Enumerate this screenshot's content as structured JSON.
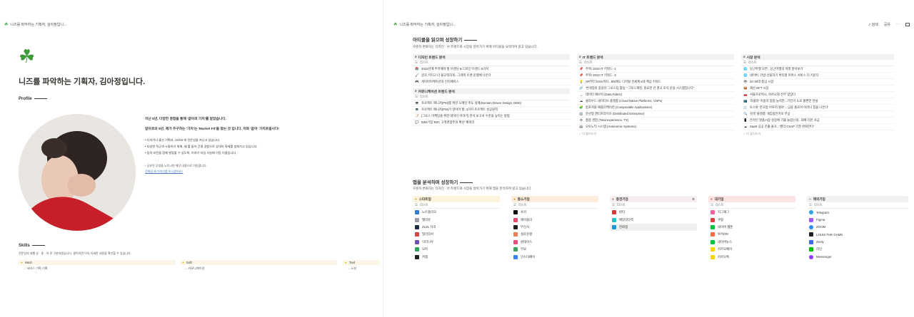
{
  "left": {
    "tab_title": "니즈를 파악하는 기획자, 김아정입니...",
    "title": "니즈를 파악하는 기획자, 김아정입니다.",
    "profile_heading": "Profile",
    "intro_1": "지난 5년, 다양한 경험을 통해 '같이의 가치'를 알았습니다.",
    "intro_2": "앞으로의 5년, 제가 추구하는 '가치'는 'Market Fit'을 찾는 것 입니다. 저와 '같이' 가치로웁시다!",
    "bullets": [
      "디자이너 출신 기획자, UX/UI 에 전문성을 지니고 있습니다.",
      "다양한 직군과 소통하기 위해, 왜 를 들어 간결 경험으로 상대의 화제를 설파가고 있습니다.",
      "팀의 비전을 함께 발맞출 수 있도록, 이야기 지길 사실에 이동 이름입니다."
    ],
    "note": "* 공유된 무엇을 노트시면 해당 내용으로 이동합니다.",
    "note_link": "전체링 왜 이야기를 보시겠어요?",
    "skills_heading": "Skills",
    "skills_desc": "전문성의 레벨 상 · 중 · 하 로 구분하였습니다. 클릭하면 이유 자세한 내용을 확인할 수 있습니다.",
    "skill_cols": [
      {
        "title": "Hard",
        "items": [
          "서비스 기획 기획"
        ]
      },
      {
        "title": "Soft",
        "items": [
          "커뮤니케이션"
        ]
      },
      {
        "title": "Tool",
        "items": [
          "노션"
        ]
      }
    ]
  },
  "right": {
    "tab_title": "니즈를 파악하는 기획자, 김아정입니...",
    "actions": {
      "search": "검색",
      "share": "공유",
      "more": "⋯"
    },
    "section1": {
      "title": "아티클을 읽으며 성장하기",
      "desc": "꾸준히 변화하는 디자인 · IT 트렌드와 시장을 알아가기 위해 아티클을 요약하며 읽고 있습니다.",
      "list_label": "리스트",
      "more_label": "더 불러오기",
      "cards": [
        {
          "title": "디자인 트렌드 분석",
          "rows": [
            {
              "icon": "📚",
              "text": "2022년에 주목해야 할 브랜딩 & 디자인 트렌드 8가지"
            },
            {
              "icon": "🖌",
              "text": "글자 키지고 더 불규칙하게...그래픽 트렌 운행에 나온다"
            },
            {
              "icon": "🎮",
              "text": "게이미피케이션과 인터페이스"
            }
          ]
        },
        {
          "title": "커뮤니케이션 트렌드 분석",
          "rows": [
            {
              "icon": "💻",
              "text": "프로젝트 매니저(PM)를 위한 도메인 주도 설계(Domain Driven Design, DDD)"
            },
            {
              "icon": "💻",
              "text": "프로젝트 매니저(PM)가 알아야 할, 3가지 프로젝트 성공원칙"
            },
            {
              "icon": "📝",
              "text": "[그로스 마케팅을 위한 데이터 이야기] 분석 보고서 수준을 높이는 방법"
            },
            {
              "icon": "💬",
              "text": "B2B기업 'B2C 고객경험주의 확산' 배워라"
            }
          ]
        },
        {
          "title": "IT 트렌드 분석",
          "rows": [
            {
              "icon": "📌",
              "text": "주목! 2022 IT 키워드 -1"
            },
            {
              "icon": "📌",
              "text": "주목! 2022 IT 키워드 -2"
            },
            {
              "icon": "💡",
              "text": "XR부터 ESG까지...MS에도 디지털 전세계 5대 핵심 키워드"
            },
            {
              "icon": "🔗",
              "text": "'변개장터 중용된 그로스팀 활동' \"그로스해킹, 중요한 건 결국 조직 운용 시스템입니다\""
            },
            {
              "icon": "↔",
              "text": "데이터 패브릭 (Data Fabric)"
            },
            {
              "icon": "☁",
              "text": "클라우드 네이티브 플랫폼 (Cloud Native Platforms, CNPs)"
            },
            {
              "icon": "🧩",
              "text": "컴포저블 애플리케이션 (Composable Applications)"
            },
            {
              "icon": "🏢",
              "text": "분산형 엔터프라이즈 (Distributed Enterprise)"
            },
            {
              "icon": "⚙",
              "text": "총합 경험 (Total experience, TX)"
            },
            {
              "icon": "🤖",
              "text": "오토노믹 시스템 (Autonomic Systems)"
            }
          ]
        },
        {
          "title": "시장 분석",
          "rows": [
            {
              "icon": "🌐",
              "text": "당근마켓 모른...당근마켓의 미래 알아보기"
            },
            {
              "icon": "🌐",
              "text": "네이버, 라방·선물하기 버티컬 커머스 서비스 더 키운다"
            },
            {
              "icon": "👁",
              "text": "20·30대 충심 시장"
            },
            {
              "icon": "📦",
              "text": "재산 NFT 시장"
            },
            {
              "icon": "🚗",
              "text": "서울가로택시, 카카오와 전부 맞장다"
            },
            {
              "icon": "📺",
              "text": "'라플라' 이용자 점점 늘지만...가전거 도로 불편한 현실"
            },
            {
              "icon": "🛒",
              "text": "토스와 '한국형 이루러 될까'...'금융 플로어 이러니 칩을 나온다'"
            },
            {
              "icon": "🔍",
              "text": "검색 '플랫폼' 게임링인키로 부상"
            },
            {
              "icon": "📱",
              "text": "온라인 명품시장 성장에 기울 늘었는데...대체 더몬 사금"
            },
            {
              "icon": "☁",
              "text": "SaaS 공공 진출 물꼬...'벤더 CSAP 기준 완화한다'"
            }
          ]
        }
      ]
    },
    "section2": {
      "title": "앱을 분석하며 성장하기",
      "desc": "꾸준히 변화하는 디자인 · IT 트렌드와 시장을 알아가기 위해 앱을 분석하며 읽고 있습니다.",
      "list_label": "리스트",
      "groups": [
        {
          "title": "스타트업",
          "color": "#fbf3db",
          "items": [
            {
              "name": "노트플리오",
              "color": "#2b7bd4"
            },
            {
              "name": "밸리유",
              "color": "#9aa0a6"
            },
            {
              "name": "ZLZL 지리",
              "color": "#1f2a44"
            },
            {
              "name": "밀리의서",
              "color": "#d64545"
            },
            {
              "name": "닥터나우",
              "color": "#6b4fbb"
            },
            {
              "name": "모아",
              "color": "#2ea35a"
            },
            {
              "name": "카랩",
              "color": "#222222"
            }
          ]
        },
        {
          "title": "중소기업",
          "color": "#fbecdd",
          "items": [
            {
              "name": "쏘카",
              "color": "#111111"
            },
            {
              "name": "에이블리",
              "color": "#e64b6b"
            },
            {
              "name": "무신사",
              "color": "#222222"
            },
            {
              "name": "설로운평",
              "color": "#ef7d52"
            },
            {
              "name": "원데이스",
              "color": "#ea4f7a"
            },
            {
              "name": "무료",
              "color": "#3aa55a"
            },
            {
              "name": "인스타페이",
              "color": "#3b82f6"
            }
          ]
        },
        {
          "title": "중견기업",
          "color": "#f4eeee",
          "items": [
            {
              "name": "핀터",
              "color": "#d43b3b"
            },
            {
              "name": "배달의민족",
              "color": "#28c1c1"
            },
            {
              "name": "한화앱",
              "color": "#1b9ad6"
            }
          ]
        },
        {
          "title": "대기업",
          "color": "#fbe4e4",
          "items": [
            {
              "name": "지그재그",
              "color": "#ff5fa2"
            },
            {
              "name": "쿠팡",
              "color": "#e23b3b"
            },
            {
              "name": "네이버 웹툰",
              "color": "#00c73c"
            },
            {
              "name": "투어ON",
              "color": "#ff6a3d"
            },
            {
              "name": "네이버뉴스",
              "color": "#00c73c"
            },
            {
              "name": "카카오페이",
              "color": "#f7d600"
            },
            {
              "name": "카카오톡",
              "color": "#f7d600"
            }
          ]
        },
        {
          "title": "해외기업",
          "color": "#f1f1ef",
          "items": [
            {
              "name": "Telegram",
              "color": "#2aa3e0"
            },
            {
              "name": "Figma",
              "color": "#a259ff"
            },
            {
              "name": "ZOOM",
              "color": "#2d8cff"
            },
            {
              "name": "LOUIS THE GAME",
              "color": "#222222"
            },
            {
              "name": "Zenly",
              "color": "#3c6df0"
            },
            {
              "name": "라인",
              "color": "#00c300"
            },
            {
              "name": "Messenger",
              "color": "#8a3ffc"
            }
          ]
        }
      ]
    }
  }
}
